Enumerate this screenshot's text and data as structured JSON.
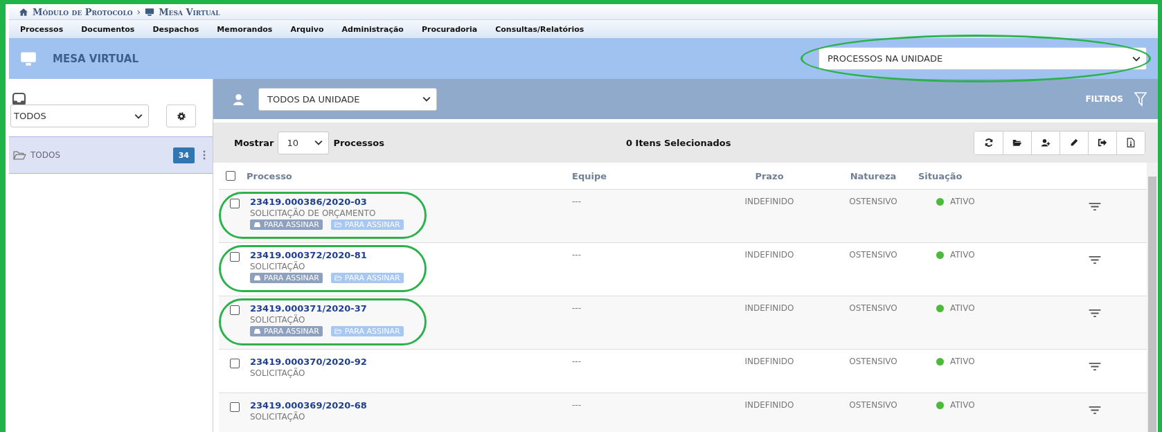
{
  "breadcrumb": {
    "separator": "›",
    "items": [
      {
        "kind": "home",
        "label": "Módulo de Protocolo"
      },
      {
        "kind": "monitor",
        "label": "Mesa Virtual"
      }
    ]
  },
  "menu": [
    "Processos",
    "Documentos",
    "Despachos",
    "Memorandos",
    "Arquivo",
    "Administração",
    "Procuradoria",
    "Consultas/Relatórios"
  ],
  "header": {
    "title": "MESA VIRTUAL",
    "unit_select": {
      "value": "PROCESSOS NA UNIDADE",
      "highlighted": true
    }
  },
  "sidebar": {
    "filter_select": "TODOS",
    "folders": [
      {
        "label": "TODOS",
        "count": "34",
        "selected": true
      }
    ]
  },
  "toolbar": {
    "user_select": "TODOS DA UNIDADE",
    "filters_label": "FILTROS"
  },
  "list_bar": {
    "show_label": "Mostrar",
    "page_size": "10",
    "items_label": "Processos",
    "selection_count": "0 Itens Selecionados",
    "actions": [
      {
        "kind": "refresh"
      },
      {
        "kind": "folder"
      },
      {
        "kind": "user-plus"
      },
      {
        "kind": "pencil"
      },
      {
        "kind": "sign-out"
      },
      {
        "kind": "file"
      }
    ]
  },
  "table": {
    "all_checked": false,
    "columns": [
      "Processo",
      "Equipe",
      "Prazo",
      "Natureza",
      "Situação"
    ],
    "rows": [
      {
        "checked": false,
        "highlighted": true,
        "number": "23419.000386/2020-03",
        "subject": "SOLICITAÇÃO DE ORÇAMENTO",
        "tags": [
          {
            "kind": "inbox",
            "label": "PARA ASSINAR"
          },
          {
            "kind": "folder",
            "label": "PARA ASSINAR"
          }
        ],
        "team": "---",
        "deadline": "INDEFINIDO",
        "nature": "OSTENSIVO",
        "status": "ATIVO",
        "color": "#4cbb3a"
      },
      {
        "checked": false,
        "highlighted": true,
        "number": "23419.000372/2020-81",
        "subject": "SOLICITAÇÃO",
        "tags": [
          {
            "kind": "inbox",
            "label": "PARA ASSINAR"
          },
          {
            "kind": "folder",
            "label": "PARA ASSINAR"
          }
        ],
        "team": "---",
        "deadline": "INDEFINIDO",
        "nature": "OSTENSIVO",
        "status": "ATIVO",
        "color": "#4cbb3a"
      },
      {
        "checked": false,
        "highlighted": true,
        "number": "23419.000371/2020-37",
        "subject": "SOLICITAÇÃO",
        "tags": [
          {
            "kind": "inbox",
            "label": "PARA ASSINAR"
          },
          {
            "kind": "folder",
            "label": "PARA ASSINAR"
          }
        ],
        "team": "---",
        "deadline": "INDEFINIDO",
        "nature": "OSTENSIVO",
        "status": "ATIVO",
        "color": "#4cbb3a"
      },
      {
        "checked": false,
        "highlighted": false,
        "number": "23419.000370/2020-92",
        "subject": "SOLICITAÇÃO",
        "tags": [],
        "team": "---",
        "deadline": "INDEFINIDO",
        "nature": "OSTENSIVO",
        "status": "ATIVO",
        "color": "#4cbb3a"
      },
      {
        "checked": false,
        "highlighted": false,
        "number": "23419.000369/2020-68",
        "subject": "SOLICITAÇÃO",
        "tags": [],
        "team": "---",
        "deadline": "INDEFINIDO",
        "nature": "OSTENSIVO",
        "status": "ATIVO",
        "color": "#4cbb3a"
      }
    ]
  }
}
